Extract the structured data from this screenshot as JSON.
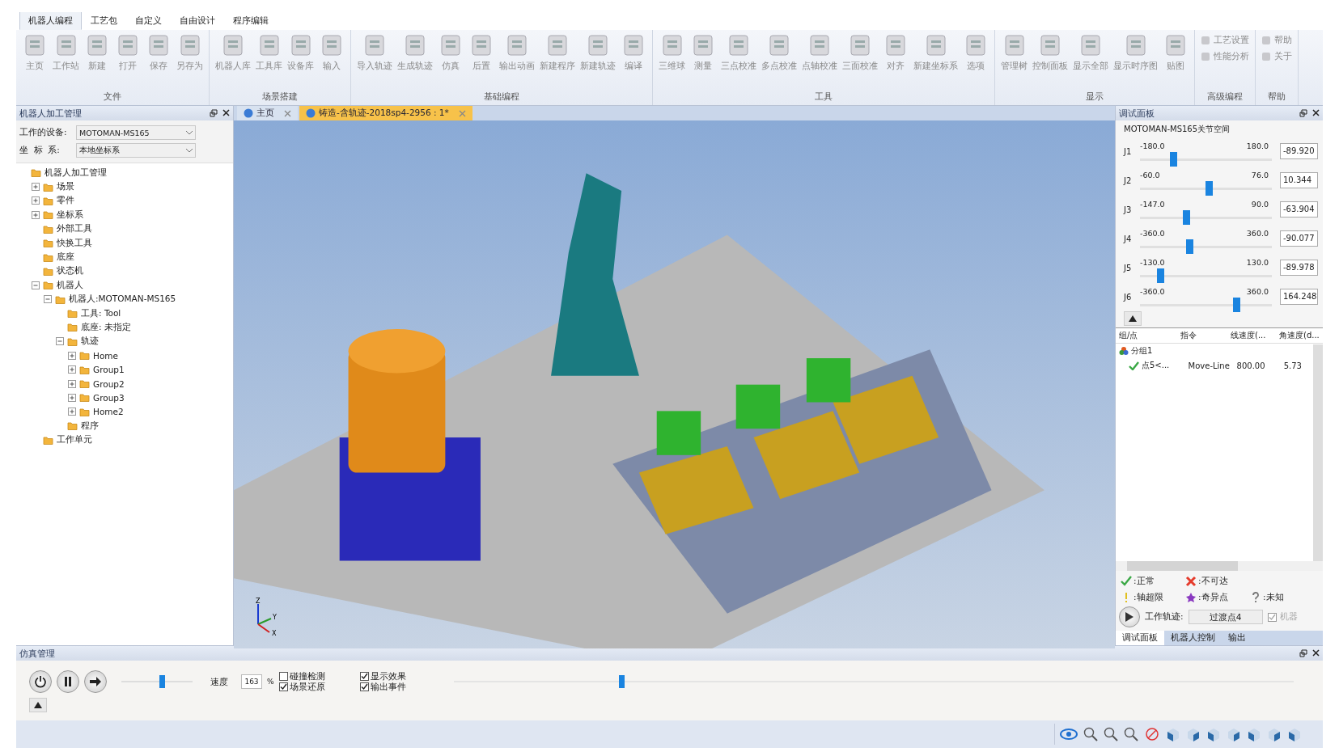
{
  "ribbon": {
    "tabs": [
      {
        "label": "机器人编程",
        "selected": true
      },
      {
        "label": "工艺包",
        "selected": false
      },
      {
        "label": "自定义",
        "selected": false
      },
      {
        "label": "自由设计",
        "selected": false
      },
      {
        "label": "程序编辑",
        "selected": false
      }
    ],
    "groups": [
      {
        "label": "文件",
        "buttons": [
          {
            "label": "主页",
            "kind": "large"
          },
          {
            "label": "工作站",
            "kind": "large"
          },
          {
            "label": "新建",
            "kind": "large"
          },
          {
            "label": "打开",
            "kind": "large"
          },
          {
            "label": "保存",
            "kind": "large"
          },
          {
            "label": "另存为",
            "kind": "large"
          }
        ]
      },
      {
        "label": "场景搭建",
        "buttons": [
          {
            "label": "机器人库",
            "kind": "large"
          },
          {
            "label": "工具库",
            "kind": "large"
          },
          {
            "label": "设备库",
            "kind": "large"
          },
          {
            "label": "输入",
            "kind": "large"
          }
        ]
      },
      {
        "label": "基础编程",
        "buttons": [
          {
            "label": "导入轨迹",
            "kind": "large"
          },
          {
            "label": "生成轨迹",
            "kind": "large"
          },
          {
            "label": "仿真",
            "kind": "large"
          },
          {
            "label": "后置",
            "kind": "large"
          },
          {
            "label": "输出动画",
            "kind": "large"
          },
          {
            "label": "新建程序",
            "kind": "large"
          },
          {
            "label": "新建轨迹",
            "kind": "large"
          },
          {
            "label": "编译",
            "kind": "large"
          }
        ]
      },
      {
        "label": "工具",
        "buttons": [
          {
            "label": "三维球",
            "kind": "large"
          },
          {
            "label": "测量",
            "kind": "large"
          },
          {
            "label": "三点校准",
            "kind": "large"
          },
          {
            "label": "多点校准",
            "kind": "large"
          },
          {
            "label": "点轴校准",
            "kind": "large"
          },
          {
            "label": "三面校准",
            "kind": "large"
          },
          {
            "label": "对齐",
            "kind": "large"
          },
          {
            "label": "新建坐标系",
            "kind": "large"
          },
          {
            "label": "选项",
            "kind": "large"
          }
        ]
      },
      {
        "label": "显示",
        "buttons": [
          {
            "label": "管理树",
            "kind": "large"
          },
          {
            "label": "控制面板",
            "kind": "large"
          },
          {
            "label": "显示全部",
            "kind": "large"
          },
          {
            "label": "显示时序图",
            "kind": "large"
          },
          {
            "label": "贴图",
            "kind": "large"
          }
        ]
      },
      {
        "label": "高级编程",
        "buttons": [
          {
            "label": "工艺设置",
            "kind": "small"
          },
          {
            "label": "性能分析",
            "kind": "small"
          }
        ]
      },
      {
        "label": "帮助",
        "buttons": [
          {
            "label": "帮助",
            "kind": "small"
          },
          {
            "label": "关于",
            "kind": "small"
          }
        ]
      }
    ]
  },
  "left_panel": {
    "title": "机器人加工管理",
    "fields": [
      {
        "label": "工作的设备:",
        "value": "MOTOMAN-MS165"
      },
      {
        "label": "坐  标  系:",
        "value": "本地坐标系"
      }
    ],
    "tree": [
      {
        "label": "机器人加工管理",
        "children": [
          {
            "label": "场景",
            "expanded": false
          },
          {
            "label": "零件",
            "expanded": false
          },
          {
            "label": "坐标系",
            "expanded": false
          },
          {
            "label": "外部工具"
          },
          {
            "label": "快换工具"
          },
          {
            "label": "底座"
          },
          {
            "label": "状态机"
          },
          {
            "label": "机器人",
            "expanded": true,
            "children": [
              {
                "label": "机器人:MOTOMAN-MS165",
                "expanded": true,
                "children": [
                  {
                    "label": "工具: Tool"
                  },
                  {
                    "label": "底座: 未指定"
                  },
                  {
                    "label": "轨迹",
                    "expanded": true,
                    "children": [
                      {
                        "label": "Home",
                        "expanded": false
                      },
                      {
                        "label": "Group1",
                        "expanded": false
                      },
                      {
                        "label": "Group2",
                        "expanded": false
                      },
                      {
                        "label": "Group3",
                        "expanded": false
                      },
                      {
                        "label": "Home2",
                        "expanded": false
                      }
                    ]
                  },
                  {
                    "label": "程序"
                  }
                ]
              }
            ]
          },
          {
            "label": "工作单元"
          }
        ]
      }
    ]
  },
  "viewport": {
    "tabs": [
      {
        "label": "主页",
        "selected": false
      },
      {
        "label": "铸造-含轨迹-2018sp4-2956 : 1*",
        "selected": true
      }
    ],
    "axis_labels": [
      "Z",
      "Y",
      "X"
    ]
  },
  "right_panel": {
    "title": "调试面板",
    "joint_space": "MOTOMAN-MS165关节空间",
    "joints": [
      {
        "name": "J1",
        "min": "-180.0",
        "max": "180.0",
        "level": 0.25,
        "value": "-89.920"
      },
      {
        "name": "J2",
        "min": "-60.0",
        "max": "76.0",
        "level": 0.52,
        "value": "10.344"
      },
      {
        "name": "J3",
        "min": "-147.0",
        "max": "90.0",
        "level": 0.35,
        "value": "-63.904"
      },
      {
        "name": "J4",
        "min": "-360.0",
        "max": "360.0",
        "level": 0.375,
        "value": "-90.077"
      },
      {
        "name": "J5",
        "min": "-130.0",
        "max": "130.0",
        "level": 0.154,
        "value": "-89.978"
      },
      {
        "name": "J6",
        "min": "-360.0",
        "max": "360.0",
        "level": 0.728,
        "value": "164.248"
      }
    ],
    "table": {
      "columns": [
        "组/点",
        "指令",
        "线速度(...",
        "角速度(d..."
      ],
      "rows": [
        {
          "kind": "group",
          "cells": [
            "分组1"
          ]
        },
        {
          "kind": "point",
          "cells": [
            "点5<...",
            "Move-Line",
            "800.00",
            "5.73"
          ]
        }
      ]
    },
    "legend": [
      {
        "kind": "ok",
        "label": ":正常"
      },
      {
        "kind": "unreachable",
        "label": ":不可达"
      },
      {
        "kind": "limit",
        "label": ":轴超限"
      },
      {
        "kind": "singular",
        "label": ":奇异点"
      },
      {
        "kind": "unknown",
        "label": ":未知"
      }
    ],
    "track_label": "工作轨迹:",
    "track_value": "过渡点4",
    "robot_check": {
      "label": "机器",
      "checked": true,
      "disabled": true
    },
    "bottom_tabs": [
      {
        "label": "调试面板",
        "selected": true
      },
      {
        "label": "机器人控制",
        "selected": false
      },
      {
        "label": "输出",
        "selected": false
      }
    ]
  },
  "simulation": {
    "title": "仿真管理",
    "speed_slider": {
      "level": 0.57
    },
    "speed_label": "速度",
    "speed_value": "163",
    "speed_unit": "%",
    "options": [
      {
        "label": "碰撞检测",
        "checked": false
      },
      {
        "label": "场景还原",
        "checked": true
      },
      {
        "label": "显示效果",
        "checked": true
      },
      {
        "label": "输出事件",
        "checked": true
      }
    ],
    "timeline": {
      "level": 0.2
    }
  }
}
